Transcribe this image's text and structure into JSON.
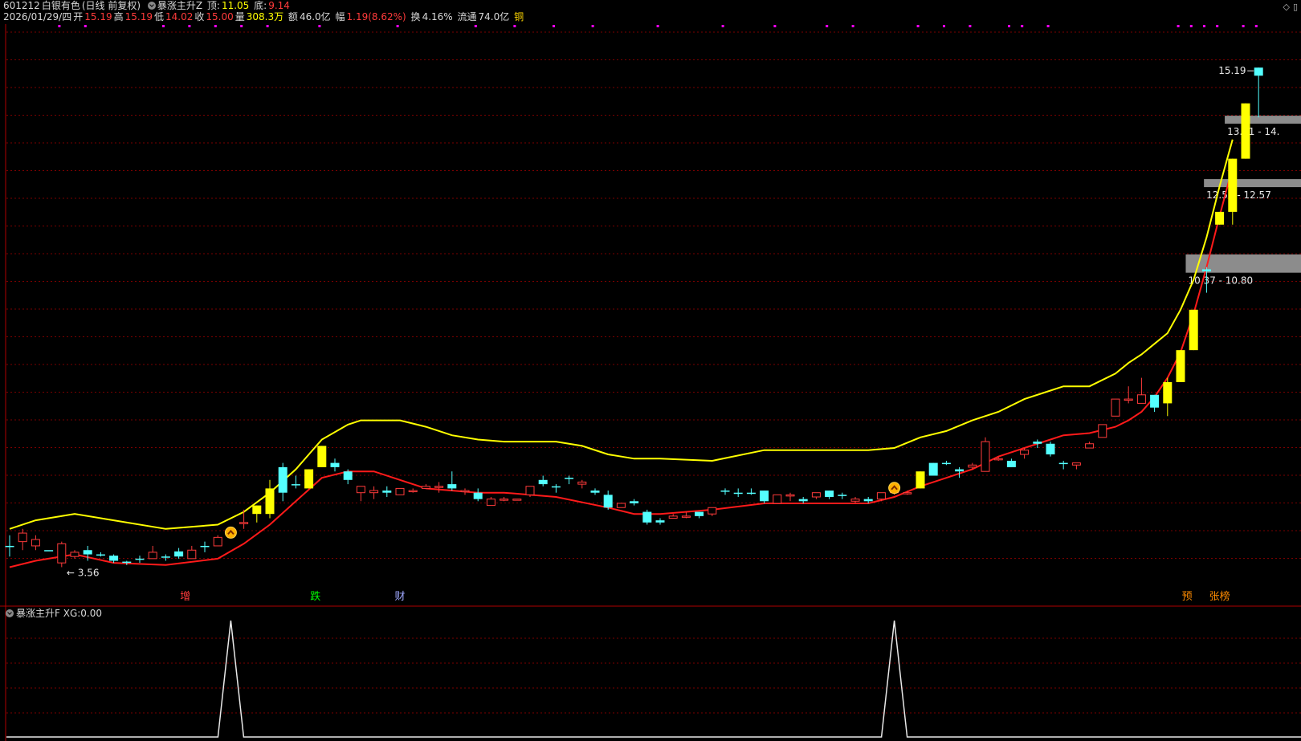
{
  "header": {
    "code": "601212",
    "name": "白银有色",
    "period": "(日线 前复权)",
    "indicator": "暴涨主升Z",
    "top_label": "顶:",
    "top_value": "11.05",
    "bottom_label": "底:",
    "bottom_value": "9.14",
    "date": "2026/01/29/四",
    "open_label": "开",
    "open": "15.19",
    "high_label": "高",
    "high": "15.19",
    "low_label": "低",
    "low": "14.02",
    "close_label": "收",
    "close": "15.00",
    "vol_label": "量",
    "vol": "308.3万",
    "amount_label": "额",
    "amount": "46.0亿",
    "change_label": "幅",
    "change": "1.19(8.62%)",
    "turnover_label": "换",
    "turnover": "4.16%",
    "float_label": "流通",
    "float": "74.0亿",
    "sector": "铜"
  },
  "sub_panel": {
    "title": "暴涨主升F",
    "xg_label": "XG:",
    "xg_value": "0.00"
  },
  "colors": {
    "up": "#ff3b3b",
    "down": "#54ffff",
    "surge": "#ffff00",
    "upper_line": "#ffff00",
    "lower_line": "#ff1a1a",
    "grid": "#7a0000",
    "zone": "#8c8c8c",
    "dot": "#ff00ff"
  },
  "chart_data": {
    "type": "candlestick",
    "ylim": [
      3.1,
      16.1
    ],
    "candles": [
      {
        "o": 3.95,
        "h": 4.2,
        "l": 3.7,
        "c": 3.95,
        "k": "down"
      },
      {
        "o": 4.05,
        "h": 4.35,
        "l": 3.85,
        "c": 4.25,
        "k": "up"
      },
      {
        "o": 3.95,
        "h": 4.2,
        "l": 3.85,
        "c": 4.1,
        "k": "up"
      },
      {
        "o": 3.85,
        "h": 3.85,
        "l": 3.85,
        "c": 3.85,
        "k": "down"
      },
      {
        "o": 3.55,
        "h": 4.05,
        "l": 3.45,
        "c": 4.0,
        "k": "up"
      },
      {
        "o": 3.7,
        "h": 3.85,
        "l": 3.65,
        "c": 3.8,
        "k": "up"
      },
      {
        "o": 3.85,
        "h": 3.95,
        "l": 3.6,
        "c": 3.75,
        "k": "down"
      },
      {
        "o": 3.75,
        "h": 3.8,
        "l": 3.7,
        "c": 3.75,
        "k": "down"
      },
      {
        "o": 3.72,
        "h": 3.75,
        "l": 3.55,
        "c": 3.6,
        "k": "down"
      },
      {
        "o": 3.58,
        "h": 3.6,
        "l": 3.5,
        "c": 3.55,
        "k": "down"
      },
      {
        "o": 3.65,
        "h": 3.72,
        "l": 3.55,
        "c": 3.65,
        "k": "down"
      },
      {
        "o": 3.65,
        "h": 3.95,
        "l": 3.65,
        "c": 3.8,
        "k": "up"
      },
      {
        "o": 3.7,
        "h": 3.75,
        "l": 3.6,
        "c": 3.7,
        "k": "down"
      },
      {
        "o": 3.82,
        "h": 3.9,
        "l": 3.65,
        "c": 3.7,
        "k": "down"
      },
      {
        "o": 3.65,
        "h": 3.95,
        "l": 3.65,
        "c": 3.85,
        "k": "up"
      },
      {
        "o": 3.95,
        "h": 4.05,
        "l": 3.8,
        "c": 3.95,
        "k": "down"
      },
      {
        "o": 3.95,
        "h": 4.2,
        "l": 3.95,
        "c": 4.15,
        "k": "up"
      },
      {
        "o": 4.3,
        "h": 4.4,
        "l": 4.2,
        "c": 4.3,
        "k": "surge"
      },
      {
        "o": 4.5,
        "h": 4.8,
        "l": 4.35,
        "c": 4.5,
        "k": "up"
      },
      {
        "o": 4.9,
        "h": 4.9,
        "l": 4.5,
        "c": 4.7,
        "k": "surge"
      },
      {
        "o": 4.7,
        "h": 5.5,
        "l": 4.6,
        "c": 5.3,
        "k": "surge"
      },
      {
        "o": 5.8,
        "h": 5.9,
        "l": 5.0,
        "c": 5.2,
        "k": "down"
      },
      {
        "o": 5.4,
        "h": 5.6,
        "l": 5.3,
        "c": 5.4,
        "k": "down"
      },
      {
        "o": 5.3,
        "h": 5.75,
        "l": 5.3,
        "c": 5.75,
        "k": "surge"
      },
      {
        "o": 5.8,
        "h": 6.3,
        "l": 5.8,
        "c": 6.3,
        "k": "surge"
      },
      {
        "o": 5.9,
        "h": 6.0,
        "l": 5.7,
        "c": 5.8,
        "k": "down"
      },
      {
        "o": 5.7,
        "h": 5.75,
        "l": 5.4,
        "c": 5.5,
        "k": "down"
      },
      {
        "o": 5.2,
        "h": 5.35,
        "l": 5.0,
        "c": 5.35,
        "k": "up"
      },
      {
        "o": 5.2,
        "h": 5.35,
        "l": 5.05,
        "c": 5.25,
        "k": "up"
      },
      {
        "o": 5.25,
        "h": 5.35,
        "l": 5.1,
        "c": 5.2,
        "k": "down"
      },
      {
        "o": 5.15,
        "h": 5.3,
        "l": 5.15,
        "c": 5.3,
        "k": "up"
      },
      {
        "o": 5.25,
        "h": 5.3,
        "l": 5.2,
        "c": 5.25,
        "k": "up"
      },
      {
        "o": 5.3,
        "h": 5.4,
        "l": 5.3,
        "c": 5.35,
        "k": "up"
      },
      {
        "o": 5.35,
        "h": 5.45,
        "l": 5.2,
        "c": 5.35,
        "k": "up"
      },
      {
        "o": 5.4,
        "h": 5.7,
        "l": 5.25,
        "c": 5.3,
        "k": "down"
      },
      {
        "o": 5.25,
        "h": 5.3,
        "l": 5.15,
        "c": 5.25,
        "k": "up"
      },
      {
        "o": 5.2,
        "h": 5.3,
        "l": 5.0,
        "c": 5.05,
        "k": "down"
      },
      {
        "o": 4.9,
        "h": 5.1,
        "l": 4.9,
        "c": 5.05,
        "k": "up"
      },
      {
        "o": 5.05,
        "h": 5.1,
        "l": 5.0,
        "c": 5.05,
        "k": "up"
      },
      {
        "o": 5.05,
        "h": 5.05,
        "l": 5.05,
        "c": 5.05,
        "k": "up"
      },
      {
        "o": 5.15,
        "h": 5.35,
        "l": 5.1,
        "c": 5.35,
        "k": "up"
      },
      {
        "o": 5.5,
        "h": 5.6,
        "l": 5.35,
        "c": 5.4,
        "k": "down"
      },
      {
        "o": 5.35,
        "h": 5.4,
        "l": 5.2,
        "c": 5.35,
        "k": "down"
      },
      {
        "o": 5.55,
        "h": 5.6,
        "l": 5.4,
        "c": 5.55,
        "k": "down"
      },
      {
        "o": 5.45,
        "h": 5.5,
        "l": 5.3,
        "c": 5.4,
        "k": "up"
      },
      {
        "o": 5.25,
        "h": 5.3,
        "l": 5.15,
        "c": 5.2,
        "k": "down"
      },
      {
        "o": 5.15,
        "h": 5.25,
        "l": 4.8,
        "c": 4.85,
        "k": "down"
      },
      {
        "o": 4.85,
        "h": 4.95,
        "l": 4.85,
        "c": 4.95,
        "k": "up"
      },
      {
        "o": 5.0,
        "h": 5.05,
        "l": 4.9,
        "c": 4.95,
        "k": "down"
      },
      {
        "o": 4.75,
        "h": 4.8,
        "l": 4.45,
        "c": 4.5,
        "k": "down"
      },
      {
        "o": 4.55,
        "h": 4.6,
        "l": 4.45,
        "c": 4.5,
        "k": "down"
      },
      {
        "o": 4.6,
        "h": 4.7,
        "l": 4.6,
        "c": 4.65,
        "k": "up"
      },
      {
        "o": 4.65,
        "h": 4.75,
        "l": 4.6,
        "c": 4.65,
        "k": "up"
      },
      {
        "o": 4.65,
        "h": 4.75,
        "l": 4.6,
        "c": 4.75,
        "k": "down"
      },
      {
        "o": 4.7,
        "h": 4.85,
        "l": 4.65,
        "c": 4.85,
        "k": "up"
      },
      {
        "o": 5.25,
        "h": 5.3,
        "l": 5.15,
        "c": 5.25,
        "k": "down"
      },
      {
        "o": 5.2,
        "h": 5.3,
        "l": 5.1,
        "c": 5.2,
        "k": "down"
      },
      {
        "o": 5.2,
        "h": 5.3,
        "l": 5.15,
        "c": 5.2,
        "k": "down"
      },
      {
        "o": 5.25,
        "h": 5.25,
        "l": 4.95,
        "c": 5.0,
        "k": "down"
      },
      {
        "o": 4.95,
        "h": 5.15,
        "l": 4.95,
        "c": 5.15,
        "k": "up"
      },
      {
        "o": 5.15,
        "h": 5.2,
        "l": 5.0,
        "c": 5.15,
        "k": "up"
      },
      {
        "o": 5.05,
        "h": 5.1,
        "l": 4.95,
        "c": 5.0,
        "k": "down"
      },
      {
        "o": 5.1,
        "h": 5.2,
        "l": 5.05,
        "c": 5.2,
        "k": "up"
      },
      {
        "o": 5.25,
        "h": 5.25,
        "l": 5.05,
        "c": 5.1,
        "k": "down"
      },
      {
        "o": 5.15,
        "h": 5.2,
        "l": 5.05,
        "c": 5.15,
        "k": "down"
      },
      {
        "o": 5.0,
        "h": 5.1,
        "l": 4.95,
        "c": 5.05,
        "k": "up"
      },
      {
        "o": 5.05,
        "h": 5.1,
        "l": 4.95,
        "c": 5.0,
        "k": "down"
      },
      {
        "o": 5.05,
        "h": 5.2,
        "l": 5.0,
        "c": 5.2,
        "k": "up"
      },
      {
        "o": 5.2,
        "h": 5.35,
        "l": 5.15,
        "c": 5.25,
        "k": "up"
      },
      {
        "o": 5.2,
        "h": 5.25,
        "l": 5.15,
        "c": 5.2,
        "k": "up"
      },
      {
        "o": 5.3,
        "h": 5.7,
        "l": 5.3,
        "c": 5.7,
        "k": "surge"
      },
      {
        "o": 5.6,
        "h": 5.9,
        "l": 5.6,
        "c": 5.9,
        "k": "down"
      },
      {
        "o": 5.9,
        "h": 5.95,
        "l": 5.85,
        "c": 5.9,
        "k": "down"
      },
      {
        "o": 5.75,
        "h": 5.8,
        "l": 5.55,
        "c": 5.7,
        "k": "down"
      },
      {
        "o": 5.8,
        "h": 5.9,
        "l": 5.75,
        "c": 5.85,
        "k": "up"
      },
      {
        "o": 5.7,
        "h": 6.5,
        "l": 5.7,
        "c": 6.4,
        "k": "up"
      },
      {
        "o": 6.0,
        "h": 6.05,
        "l": 5.95,
        "c": 6.0,
        "k": "up"
      },
      {
        "o": 5.95,
        "h": 6.0,
        "l": 5.8,
        "c": 5.8,
        "k": "down"
      },
      {
        "o": 6.1,
        "h": 6.25,
        "l": 6.0,
        "c": 6.2,
        "k": "up"
      },
      {
        "o": 6.4,
        "h": 6.45,
        "l": 6.25,
        "c": 6.35,
        "k": "down"
      },
      {
        "o": 6.35,
        "h": 6.4,
        "l": 6.05,
        "c": 6.1,
        "k": "down"
      },
      {
        "o": 5.9,
        "h": 5.95,
        "l": 5.75,
        "c": 5.9,
        "k": "down"
      },
      {
        "o": 5.9,
        "h": 5.9,
        "l": 5.75,
        "c": 5.85,
        "k": "up"
      },
      {
        "o": 6.25,
        "h": 6.4,
        "l": 6.25,
        "c": 6.35,
        "k": "up"
      },
      {
        "o": 6.5,
        "h": 6.8,
        "l": 6.5,
        "c": 6.8,
        "k": "up"
      },
      {
        "o": 7.0,
        "h": 7.4,
        "l": 7.0,
        "c": 7.4,
        "k": "up"
      },
      {
        "o": 7.4,
        "h": 7.7,
        "l": 7.3,
        "c": 7.4,
        "k": "up"
      },
      {
        "o": 7.3,
        "h": 7.9,
        "l": 7.3,
        "c": 7.5,
        "k": "up"
      },
      {
        "o": 7.5,
        "h": 7.5,
        "l": 7.1,
        "c": 7.2,
        "k": "down"
      },
      {
        "o": 7.3,
        "h": 7.9,
        "l": 7.0,
        "c": 7.8,
        "k": "surge"
      },
      {
        "o": 7.8,
        "h": 8.55,
        "l": 7.8,
        "c": 8.55,
        "k": "surge"
      },
      {
        "o": 8.55,
        "h": 9.5,
        "l": 8.55,
        "c": 9.5,
        "k": "surge"
      },
      {
        "o": 10.4,
        "h": 10.5,
        "l": 9.9,
        "c": 10.45,
        "k": "down"
      },
      {
        "o": 11.5,
        "h": 11.8,
        "l": 11.5,
        "c": 11.8,
        "k": "surge"
      },
      {
        "o": 11.8,
        "h": 13.05,
        "l": 11.5,
        "c": 13.05,
        "k": "surge"
      },
      {
        "o": 13.05,
        "h": 14.35,
        "l": 13.05,
        "c": 14.35,
        "k": "surge"
      },
      {
        "o": 15.0,
        "h": 15.19,
        "l": 14.02,
        "c": 15.19,
        "k": "down"
      }
    ],
    "upper_band": [
      [
        0,
        4.35
      ],
      [
        2,
        4.55
      ],
      [
        5,
        4.7
      ],
      [
        8,
        4.55
      ],
      [
        12,
        4.35
      ],
      [
        16,
        4.45
      ],
      [
        18,
        4.75
      ],
      [
        20,
        5.2
      ],
      [
        22,
        5.75
      ],
      [
        24,
        6.45
      ],
      [
        26,
        6.8
      ],
      [
        27,
        6.9
      ],
      [
        30,
        6.9
      ],
      [
        32,
        6.75
      ],
      [
        34,
        6.55
      ],
      [
        36,
        6.45
      ],
      [
        38,
        6.4
      ],
      [
        42,
        6.4
      ],
      [
        44,
        6.3
      ],
      [
        46,
        6.1
      ],
      [
        48,
        6.0
      ],
      [
        50,
        6.0
      ],
      [
        54,
        5.95
      ],
      [
        58,
        6.2
      ],
      [
        62,
        6.2
      ],
      [
        66,
        6.2
      ],
      [
        68,
        6.25
      ],
      [
        70,
        6.5
      ],
      [
        72,
        6.65
      ],
      [
        74,
        6.9
      ],
      [
        76,
        7.1
      ],
      [
        78,
        7.4
      ],
      [
        80,
        7.6
      ],
      [
        81,
        7.7
      ],
      [
        83,
        7.7
      ],
      [
        85,
        8.0
      ],
      [
        86,
        8.25
      ],
      [
        87,
        8.45
      ],
      [
        88,
        8.7
      ],
      [
        89,
        8.95
      ],
      [
        90,
        9.5
      ],
      [
        91,
        10.2
      ],
      [
        92,
        11.2
      ],
      [
        93,
        12.4
      ],
      [
        94,
        13.5
      ]
    ],
    "lower_band": [
      [
        0,
        3.45
      ],
      [
        2,
        3.6
      ],
      [
        5,
        3.75
      ],
      [
        8,
        3.55
      ],
      [
        12,
        3.5
      ],
      [
        16,
        3.65
      ],
      [
        18,
        4.0
      ],
      [
        20,
        4.45
      ],
      [
        22,
        5.0
      ],
      [
        24,
        5.55
      ],
      [
        26,
        5.7
      ],
      [
        28,
        5.7
      ],
      [
        30,
        5.5
      ],
      [
        32,
        5.3
      ],
      [
        36,
        5.2
      ],
      [
        38,
        5.2
      ],
      [
        42,
        5.1
      ],
      [
        46,
        4.85
      ],
      [
        48,
        4.7
      ],
      [
        50,
        4.7
      ],
      [
        54,
        4.8
      ],
      [
        58,
        4.95
      ],
      [
        62,
        4.95
      ],
      [
        66,
        4.95
      ],
      [
        68,
        5.1
      ],
      [
        70,
        5.35
      ],
      [
        72,
        5.55
      ],
      [
        74,
        5.75
      ],
      [
        76,
        6.05
      ],
      [
        78,
        6.25
      ],
      [
        80,
        6.45
      ],
      [
        81,
        6.55
      ],
      [
        83,
        6.6
      ],
      [
        85,
        6.75
      ],
      [
        86,
        6.9
      ],
      [
        87,
        7.1
      ],
      [
        88,
        7.45
      ],
      [
        89,
        7.9
      ],
      [
        90,
        8.5
      ],
      [
        91,
        9.4
      ],
      [
        92,
        10.5
      ],
      [
        93,
        11.7
      ],
      [
        94,
        12.85
      ]
    ],
    "zones": [
      {
        "label": "13.81 - 14.",
        "from_index": 93.4,
        "top": 14.06,
        "bottom": 13.92
      },
      {
        "label": "12.55 - 12.57",
        "from_index": 91.8,
        "top": 12.57,
        "bottom": 12.55
      },
      {
        "label": "10.37 - 10.80",
        "from_index": 90.4,
        "top": 10.8,
        "bottom": 10.37
      }
    ],
    "highest_label": "15.19",
    "lowest_label": "← 3.56",
    "lowest_index": 4.5,
    "lowest_value": 3.56,
    "buy_signals": [
      {
        "index": 17,
        "value": 4.3
      },
      {
        "index": 68,
        "value": 5.35
      }
    ],
    "event_labels": [
      {
        "text": "增",
        "index": 13.5,
        "color": "#ff3b3b"
      },
      {
        "text": "跌",
        "index": 23.5,
        "color": "#00ff00"
      },
      {
        "text": "财",
        "index": 30,
        "color": "#9fa8ff"
      },
      {
        "text": "预",
        "index": 90.5,
        "color": "#ff8c00"
      },
      {
        "text": "张榜",
        "index": 93,
        "color": "#ff8c00"
      }
    ],
    "sub_series": {
      "type": "line",
      "spikes_at": [
        17,
        68
      ],
      "ylim": [
        0,
        1
      ]
    }
  }
}
